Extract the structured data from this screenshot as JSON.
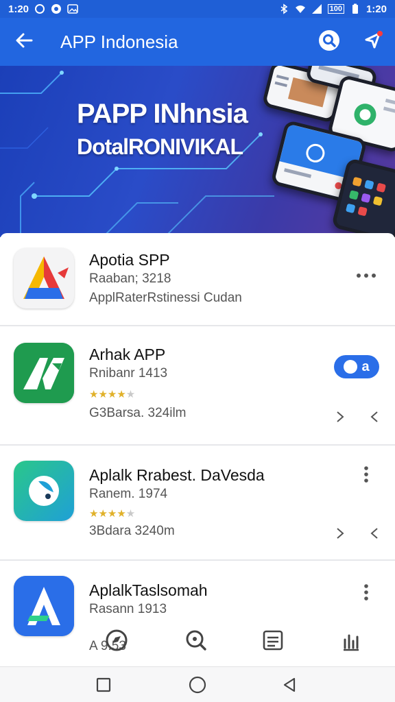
{
  "status_bar": {
    "time_left": "1:20",
    "time_right": "1:20",
    "battery_label": "100",
    "icons": [
      "notification-icon",
      "chat-icon",
      "image-icon",
      "bluetooth-icon",
      "wifi-icon",
      "signal-icon",
      "battery-icon"
    ]
  },
  "app_bar": {
    "title": "APP Indonesia",
    "back_icon": "arrow-left-icon",
    "search_icon": "search-icon",
    "share_icon": "share-icon"
  },
  "banner": {
    "title": "PAPP INhnsia",
    "subtitle": "DotalRONIVIKAL"
  },
  "apps": [
    {
      "name": "Apotia SPP",
      "meta": "Raaban; 3218",
      "desc": "ApplRaterRstinessi Cudan",
      "action": "more-horizontal-icon"
    },
    {
      "name": "Arhak APP",
      "meta": "Rnibanr 1413",
      "rating": 4,
      "desc": "G3Barsa. 324ilm",
      "badge": "a"
    },
    {
      "name": "Aplalk Rrabest. DaVesda",
      "meta": "Ranem. 1974",
      "rating": 4,
      "desc": "3Bdara 3240m"
    },
    {
      "name": "AplalkTaslsomah",
      "meta": "Rasann 1913",
      "desc": "A 9.53"
    }
  ],
  "tab_bar": {
    "icons": [
      "compass-icon",
      "search-zoom-icon",
      "list-icon",
      "bookmark-icon"
    ]
  },
  "nav_bar": {
    "icons": [
      "recent-apps-icon",
      "home-icon",
      "back-icon"
    ]
  },
  "colors": {
    "primary": "#2266e0",
    "status": "#1f5fd6",
    "star": "#e0b12a"
  }
}
